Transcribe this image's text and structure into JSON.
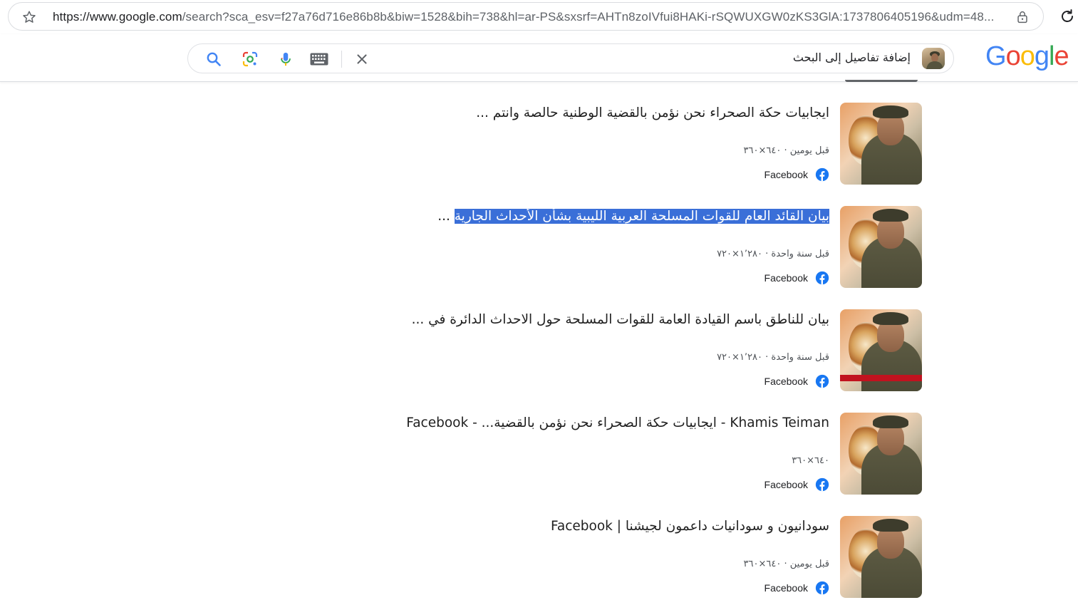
{
  "browser": {
    "url_host": "https://www.google.com",
    "url_rest": "/search?sca_esv=f27a76d716e86b8b&biw=1528&bih=738&hl=ar-PS&sxsrf=AHTn8zoIVfui8HAKi-rSQWUXGW0zKS3GlA:1737806405196&udm=48..."
  },
  "header": {
    "logo_letters": [
      {
        "ch": "G",
        "color": "#4285F4"
      },
      {
        "ch": "o",
        "color": "#EA4335"
      },
      {
        "ch": "o",
        "color": "#FBBC05"
      },
      {
        "ch": "g",
        "color": "#4285F4"
      },
      {
        "ch": "l",
        "color": "#34A853"
      },
      {
        "ch": "e",
        "color": "#EA4335"
      }
    ],
    "search_query": "إضافة تفاصيل إلى البحث"
  },
  "results": [
    {
      "title": "ايجابيات حكة الصحراء نحن نؤمن بالقضية الوطنية حالصة وانتم ...",
      "title_selected": "",
      "title_tail": "",
      "meta": "قبل يومين · ٦٤٠×٣٦٠",
      "source": "Facebook",
      "banner": false
    },
    {
      "title": "",
      "title_selected": "بيان القائد العام للقوات المسلحة العربية الليبية بشأن الأحداث الجارية",
      "title_tail": " ...",
      "meta": "قبل سنة واحدة · ١٬٢٨٠×٧٢٠",
      "source": "Facebook",
      "banner": false
    },
    {
      "title": "بيان للناطق باسم القيادة العامة للقوات المسلحة حول الاحداث الدائرة في ...",
      "title_selected": "",
      "title_tail": "",
      "meta": "قبل سنة واحدة · ١٬٢٨٠×٧٢٠",
      "source": "Facebook",
      "banner": true
    },
    {
      "title": "Khamis Teiman - ايجابيات حكة الصحراء نحن نؤمن بالقضية... - Facebook",
      "title_selected": "",
      "title_tail": "",
      "meta": "٦٤٠×٣٦٠",
      "source": "Facebook",
      "banner": false
    },
    {
      "title": "سودانيون و سودانيات داعمون لجيشنا | Facebook",
      "title_selected": "",
      "title_tail": "",
      "meta": "قبل يومين · ٦٤٠×٣٦٠",
      "source": "Facebook",
      "banner": false
    }
  ],
  "colors": {
    "selection": "#3a6fd8",
    "facebook": "#1877F2"
  }
}
